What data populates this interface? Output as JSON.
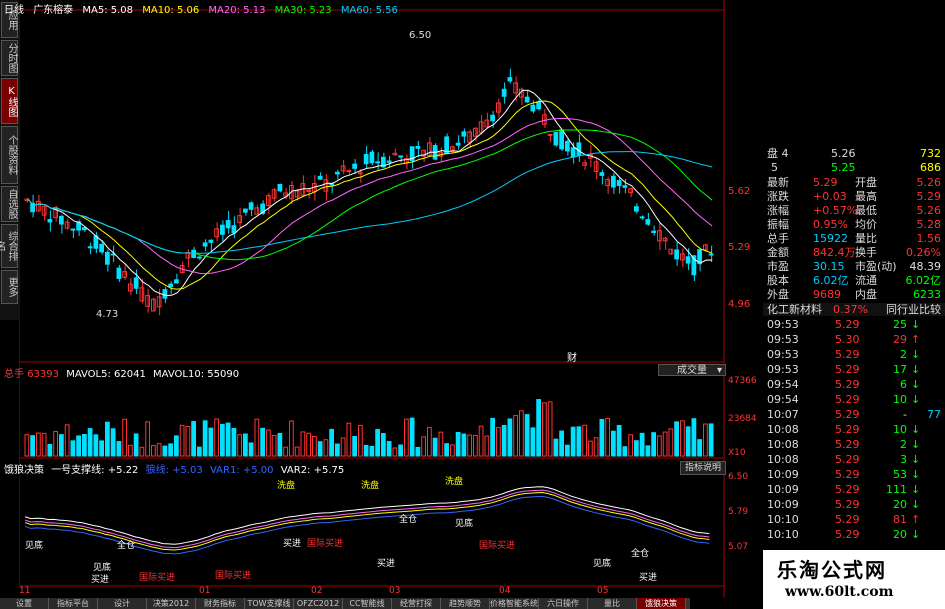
{
  "left_tabs": [
    {
      "label": "应用",
      "active": false
    },
    {
      "label": "分时图",
      "active": false
    },
    {
      "label": "K线图",
      "active": true
    },
    {
      "label": "个股资料",
      "active": false
    },
    {
      "label": "自选股",
      "active": false
    },
    {
      "label": "综合排名",
      "active": false
    },
    {
      "label": "更多",
      "active": false
    }
  ],
  "main_header": {
    "period": "日线",
    "stock": "广东榕泰",
    "ma5": "MA5: 5.08",
    "ma10": "MA10: 5.06",
    "ma20": "MA20: 5.13",
    "ma30": "MA30: 5.23",
    "ma60": "MA60: 5.56"
  },
  "price_axis": [
    "5.62",
    "5.29",
    "4.96"
  ],
  "price_annotations": {
    "high": "6.50",
    "low": "4.73",
    "cai": "财"
  },
  "volume_header": {
    "label": "总手",
    "value": "63393",
    "mavol5": "MAVOL5: 62041",
    "mavol10": "MAVOL10: 55090"
  },
  "volume_dropdown": "成交量",
  "volume_axis": [
    "47366",
    "23684",
    "X10"
  ],
  "indicator_header": {
    "name": "饿狼决策",
    "line1": "一号支撑线: +5.22",
    "line2": "狼线: +5.03",
    "var1": "VAR1: +5.00",
    "var2": "VAR2: +5.75"
  },
  "indicator_button": "指标说明",
  "indicator_axis": [
    "6.50",
    "5.79",
    "5.07"
  ],
  "indicator_labels": [
    "洗盘",
    "洗盘",
    "洗盘",
    "见底",
    "见底",
    "见底",
    "见底",
    "全仓",
    "全仓",
    "全仓",
    "买进",
    "买进",
    "买进",
    "买进",
    "国际买进",
    "国际买进",
    "国际买进",
    "国际买进"
  ],
  "x_axis": [
    "11",
    "01",
    "02",
    "03",
    "04",
    "05"
  ],
  "quote": {
    "bid4_label": "盘 4",
    "bid4_price": "5.26",
    "bid4_vol": "732",
    "bid5_label": "5",
    "bid5_price": "5.25",
    "bid5_vol": "686",
    "rows": [
      [
        "最新",
        "5.29",
        "开盘",
        "5.26"
      ],
      [
        "涨跌",
        "+0.03",
        "最高",
        "5.29"
      ],
      [
        "涨幅",
        "+0.57%",
        "最低",
        "5.26"
      ],
      [
        "振幅",
        "0.95%",
        "均价",
        "5.28"
      ],
      [
        "总手",
        "15922",
        "量比",
        "1.56"
      ],
      [
        "金额",
        "842.4万",
        "换手",
        "0.26%"
      ],
      [
        "市盈",
        "30.15",
        "市盈(动)",
        "48.39"
      ],
      [
        "股本",
        "6.02亿",
        "流通",
        "6.02亿"
      ],
      [
        "外盘",
        "9689",
        "内盘",
        "6233"
      ]
    ],
    "sector": "化工新材料",
    "sector_pct": "0.37%",
    "compare": "同行业比较"
  },
  "ticks": [
    {
      "time": "09:53",
      "price": "5.29",
      "vol": "25",
      "dir": "down"
    },
    {
      "time": "09:53",
      "price": "5.30",
      "vol": "29",
      "dir": "up"
    },
    {
      "time": "09:53",
      "price": "5.29",
      "vol": "2",
      "dir": "down"
    },
    {
      "time": "09:53",
      "price": "5.29",
      "vol": "17",
      "dir": "down"
    },
    {
      "time": "09:54",
      "price": "5.29",
      "vol": "6",
      "dir": "down"
    },
    {
      "time": "09:54",
      "price": "5.29",
      "vol": "10",
      "dir": "down"
    },
    {
      "time": "10:07",
      "price": "5.29",
      "vol": "-",
      "dir": "none",
      "extra": "77"
    },
    {
      "time": "10:08",
      "price": "5.29",
      "vol": "10",
      "dir": "down"
    },
    {
      "time": "10:08",
      "price": "5.29",
      "vol": "2",
      "dir": "down"
    },
    {
      "time": "10:08",
      "price": "5.29",
      "vol": "3",
      "dir": "down"
    },
    {
      "time": "10:09",
      "price": "5.29",
      "vol": "53",
      "dir": "down"
    },
    {
      "time": "10:09",
      "price": "5.29",
      "vol": "111",
      "dir": "down"
    },
    {
      "time": "10:09",
      "price": "5.29",
      "vol": "20",
      "dir": "down"
    },
    {
      "time": "10:10",
      "price": "5.29",
      "vol": "81",
      "dir": "up"
    },
    {
      "time": "10:10",
      "price": "5.29",
      "vol": "20",
      "dir": "down"
    }
  ],
  "bottom_tabs": [
    "设置",
    "指标平台",
    "设计",
    "决策2012",
    "财务指标",
    "TOW支撑线",
    "OFZC2012",
    "CC智能线",
    "经营打探",
    "趋势顺势",
    "价格智能系统",
    "六日操作",
    "量比",
    "饿狼决策"
  ],
  "watermark": {
    "title": "乐淘公式网",
    "url": "www.60lt.com"
  },
  "colors": {
    "up": "#ff3333",
    "down": "#00e0ff",
    "ma5": "#ffffff",
    "ma10": "#ffff00",
    "ma20": "#ff66ff",
    "ma30": "#00ff00",
    "ma60": "#00ccff"
  }
}
